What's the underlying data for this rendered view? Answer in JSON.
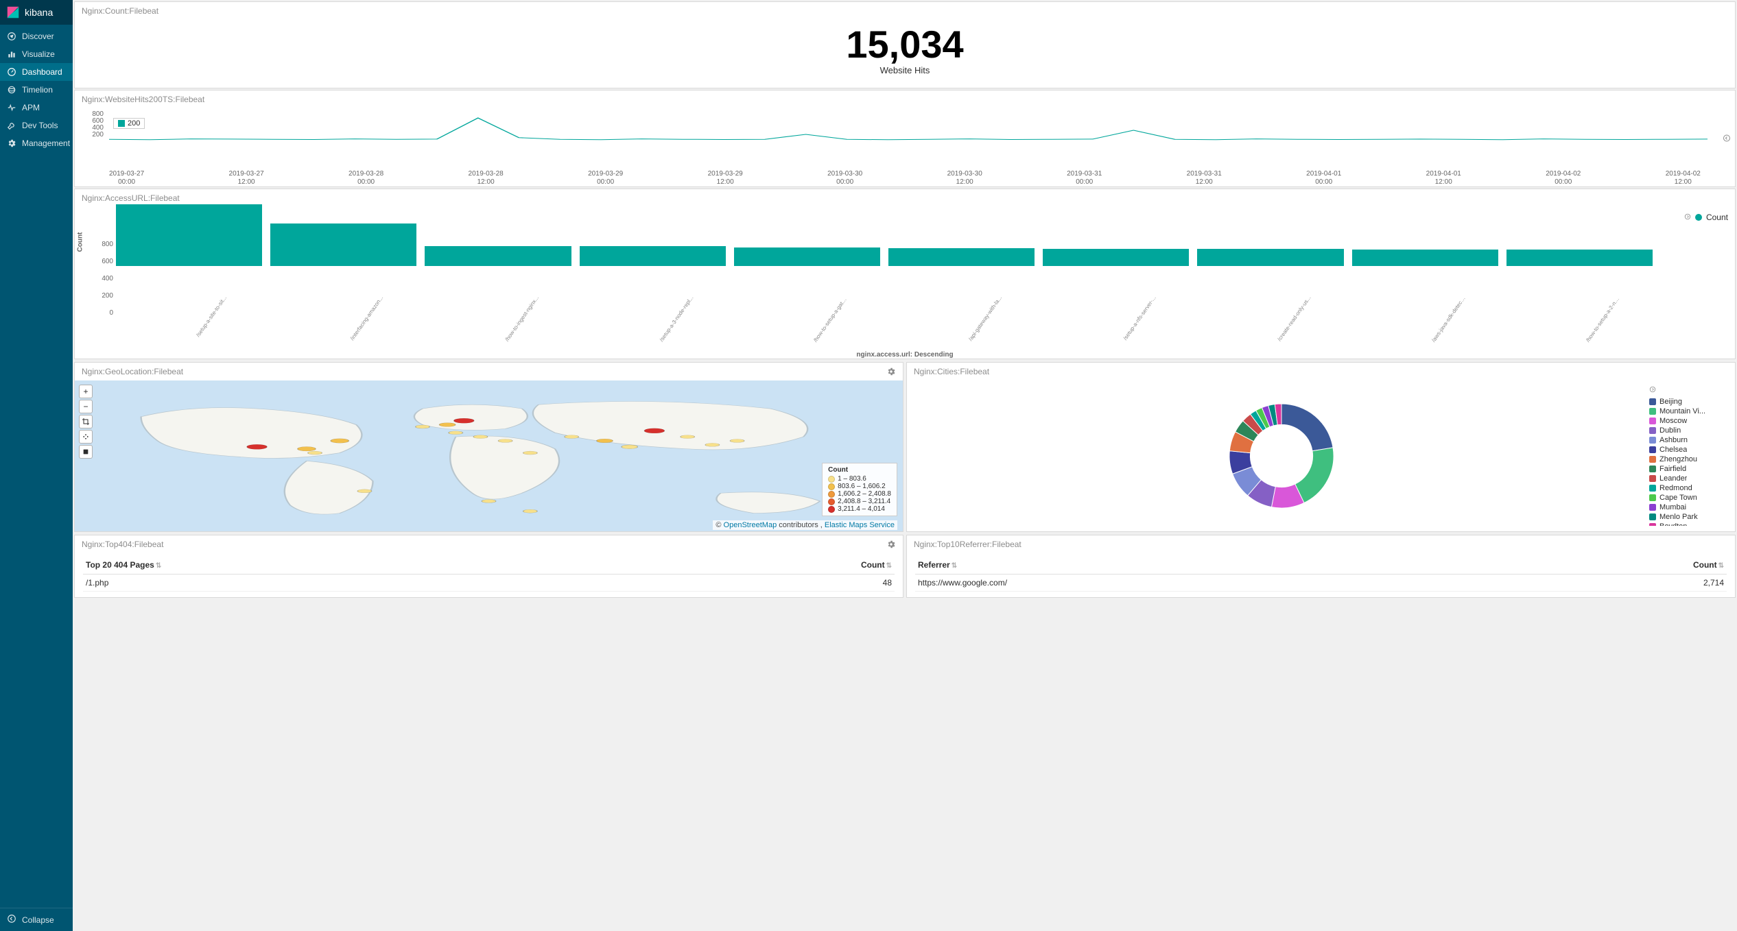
{
  "app": {
    "name": "kibana",
    "nav": [
      {
        "icon": "compass",
        "label": "Discover"
      },
      {
        "icon": "bar",
        "label": "Visualize"
      },
      {
        "icon": "dash",
        "label": "Dashboard",
        "active": true
      },
      {
        "icon": "clock",
        "label": "Timelion"
      },
      {
        "icon": "apm",
        "label": "APM"
      },
      {
        "icon": "wrench",
        "label": "Dev Tools"
      },
      {
        "icon": "gear",
        "label": "Management"
      }
    ],
    "collapse": "Collapse"
  },
  "panels": {
    "count": {
      "title": "Nginx:Count:Filebeat",
      "value": "15,034",
      "label": "Website Hits"
    },
    "line": {
      "title": "Nginx:WebsiteHits200TS:Filebeat",
      "legend": "200",
      "yticks": [
        "800",
        "600",
        "400",
        "200"
      ]
    },
    "bar": {
      "title": "Nginx:AccessURL:Filebeat",
      "legend": "Count",
      "ylabel": "Count",
      "xlabel": "nginx.access.url: Descending"
    },
    "geo": {
      "title": "Nginx:GeoLocation:Filebeat",
      "legend_title": "Count",
      "attrib_pre": "© ",
      "attrib_link1": "OpenStreetMap",
      "attrib_mid": " contributors , ",
      "attrib_link2": "Elastic Maps Service"
    },
    "cities": {
      "title": "Nginx:Cities:Filebeat"
    },
    "top404": {
      "title": "Nginx:Top404:Filebeat",
      "col1": "Top 20 404 Pages",
      "col2": "Count"
    },
    "referrer": {
      "title": "Nginx:Top10Referrer:Filebeat",
      "col1": "Referrer",
      "col2": "Count"
    }
  },
  "chart_data": {
    "metric": {
      "type": "metric",
      "value": 15034,
      "label": "Website Hits"
    },
    "line": {
      "type": "line",
      "series": [
        {
          "name": "200"
        }
      ],
      "x_ticks": [
        "2019-03-27 00:00",
        "2019-03-27 12:00",
        "2019-03-28 00:00",
        "2019-03-28 12:00",
        "2019-03-29 00:00",
        "2019-03-29 12:00",
        "2019-03-30 00:00",
        "2019-03-30 12:00",
        "2019-03-31 00:00",
        "2019-03-31 12:00",
        "2019-04-01 00:00",
        "2019-04-01 12:00",
        "2019-04-02 00:00",
        "2019-04-02 12:00"
      ],
      "ylim": [
        0,
        800
      ],
      "values": [
        80,
        70,
        90,
        85,
        80,
        75,
        90,
        80,
        85,
        600,
        120,
        80,
        70,
        90,
        80,
        75,
        80,
        200,
        80,
        70,
        80,
        90,
        75,
        80,
        85,
        300,
        80,
        70,
        90,
        80,
        75,
        80,
        85,
        80,
        70,
        90,
        80,
        75,
        80,
        85
      ]
    },
    "accessurl": {
      "type": "bar",
      "ylabel": "Count",
      "xlabel": "nginx.access.url: Descending",
      "ylim": [
        0,
        800
      ],
      "yticks": [
        0,
        200,
        400,
        600,
        800
      ],
      "categories": [
        "/setup-a-site-to-sit...",
        "/interfacing-amazon...",
        "/how-to-ingest-nginx...",
        "/setup-a-3-node-repl...",
        "/how-to-setup-a-gate...",
        "/api-gateway-with-la...",
        "/setup-a-nfs-server-...",
        "/create-read-only-us...",
        "/aws-java-sdk-detect...",
        "/how-to-setup-a-2-no..."
      ],
      "values": [
        720,
        500,
        230,
        230,
        220,
        210,
        200,
        200,
        190,
        190
      ]
    },
    "geo": {
      "type": "map",
      "legend": [
        {
          "range": "1 – 803.6",
          "color": "#f7e08b"
        },
        {
          "range": "803.6 – 1,606.2",
          "color": "#f2c04d"
        },
        {
          "range": "1,606.2 – 2,408.8",
          "color": "#ef9a3c"
        },
        {
          "range": "2,408.8 – 3,211.4",
          "color": "#e65c2e"
        },
        {
          "range": "3,211.4 – 4,014",
          "color": "#d6302c"
        }
      ],
      "markers": [
        {
          "x": 22,
          "y": 33,
          "c": "#d6302c",
          "r": 6
        },
        {
          "x": 28,
          "y": 34,
          "c": "#f2c04d",
          "r": 5
        },
        {
          "x": 32,
          "y": 30,
          "c": "#f2c04d",
          "r": 5
        },
        {
          "x": 29,
          "y": 36,
          "c": "#f7e08b",
          "r": 3
        },
        {
          "x": 42,
          "y": 23,
          "c": "#f7e08b",
          "r": 3
        },
        {
          "x": 45,
          "y": 22,
          "c": "#f2c04d",
          "r": 4
        },
        {
          "x": 47,
          "y": 20,
          "c": "#d6302c",
          "r": 6
        },
        {
          "x": 46,
          "y": 26,
          "c": "#f7e08b",
          "r": 3
        },
        {
          "x": 49,
          "y": 28,
          "c": "#f7e08b",
          "r": 3
        },
        {
          "x": 52,
          "y": 30,
          "c": "#f7e08b",
          "r": 3
        },
        {
          "x": 55,
          "y": 36,
          "c": "#f7e08b",
          "r": 3
        },
        {
          "x": 60,
          "y": 28,
          "c": "#f7e08b",
          "r": 3
        },
        {
          "x": 64,
          "y": 30,
          "c": "#f2c04d",
          "r": 4
        },
        {
          "x": 67,
          "y": 33,
          "c": "#f7e08b",
          "r": 4
        },
        {
          "x": 70,
          "y": 25,
          "c": "#d6302c",
          "r": 6
        },
        {
          "x": 74,
          "y": 28,
          "c": "#f7e08b",
          "r": 3
        },
        {
          "x": 77,
          "y": 32,
          "c": "#f7e08b",
          "r": 3
        },
        {
          "x": 80,
          "y": 30,
          "c": "#f7e08b",
          "r": 3
        },
        {
          "x": 50,
          "y": 60,
          "c": "#f7e08b",
          "r": 3
        },
        {
          "x": 55,
          "y": 65,
          "c": "#f7e08b",
          "r": 3
        },
        {
          "x": 35,
          "y": 55,
          "c": "#f7e08b",
          "r": 3
        }
      ]
    },
    "cities": {
      "type": "pie",
      "slices": [
        {
          "name": "Beijing",
          "value": 22,
          "color": "#3b5998"
        },
        {
          "name": "Mountain Vi...",
          "value": 20,
          "color": "#3fbf7f"
        },
        {
          "name": "Moscow",
          "value": 10,
          "color": "#d957d9"
        },
        {
          "name": "Dublin",
          "value": 8,
          "color": "#8560c5"
        },
        {
          "name": "Ashburn",
          "value": 8,
          "color": "#7a8cd6"
        },
        {
          "name": "Chelsea",
          "value": 7,
          "color": "#3b3f9e"
        },
        {
          "name": "Zhengzhou",
          "value": 6,
          "color": "#e07040"
        },
        {
          "name": "Fairfield",
          "value": 4,
          "color": "#2d8659"
        },
        {
          "name": "Leander",
          "value": 3,
          "color": "#c94a4a"
        },
        {
          "name": "Redmond",
          "value": 2,
          "color": "#00a69b"
        },
        {
          "name": "Cape Town",
          "value": 2,
          "color": "#4cc94c"
        },
        {
          "name": "Mumbai",
          "value": 2,
          "color": "#8b3fd1"
        },
        {
          "name": "Menlo Park",
          "value": 2,
          "color": "#008a80"
        },
        {
          "name": "Boydton",
          "value": 2,
          "color": "#d9369c"
        }
      ]
    },
    "top404": {
      "type": "table",
      "columns": [
        "Top 20 404 Pages",
        "Count"
      ],
      "rows": [
        [
          "/1.php",
          "48"
        ]
      ]
    },
    "referrer": {
      "type": "table",
      "columns": [
        "Referrer",
        "Count"
      ],
      "rows": [
        [
          "https://www.google.com/",
          "2,714"
        ]
      ]
    }
  }
}
